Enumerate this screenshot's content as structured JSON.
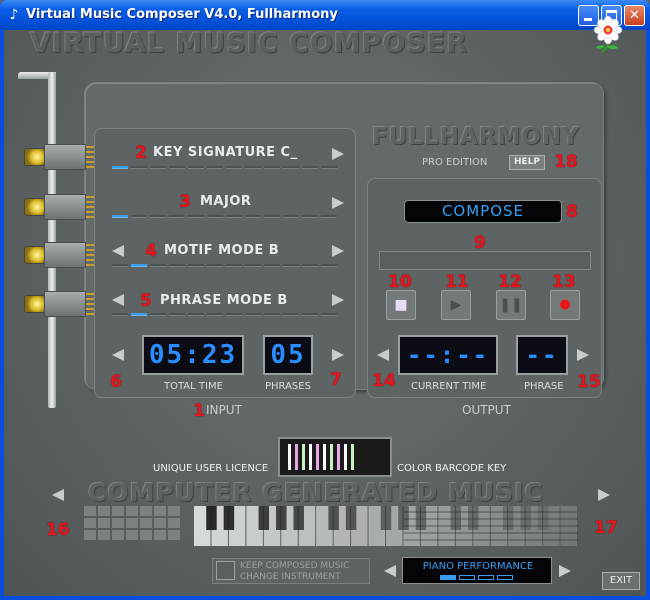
{
  "window": {
    "title": "Virtual Music Composer V4.0, Fullharmony"
  },
  "header": {
    "app_name": "VIRTUAL MUSIC COMPOSER",
    "edition_brand": "FULLHARMONY",
    "edition": "PRO EDITION",
    "help_label": "HELP"
  },
  "input": {
    "section_label": "INPUT",
    "rows": [
      {
        "badge": "2",
        "label": "KEY SIGNATURE  C_",
        "active_slot": 0
      },
      {
        "badge": "3",
        "label": "MAJOR",
        "active_slot": 0
      },
      {
        "badge": "4",
        "label": "MOTIF  MODE  B",
        "active_slot": 1
      },
      {
        "badge": "5",
        "label": "PHRASE  MODE  B",
        "active_slot": 1
      }
    ],
    "total_time": "05:23",
    "total_time_label": "TOTAL TIME",
    "phrases": "05",
    "phrases_label": "PHRASES",
    "badge_section": "1",
    "badge_left": "6",
    "badge_right": "7"
  },
  "output": {
    "section_label": "OUTPUT",
    "compose_label": "COMPOSE",
    "badge_compose": "8",
    "badge_progress": "9",
    "badge_help": "18",
    "controls": [
      {
        "badge": "10",
        "name": "stop-icon"
      },
      {
        "badge": "11",
        "name": "play-icon"
      },
      {
        "badge": "12",
        "name": "pause-icon"
      },
      {
        "badge": "13",
        "name": "record-icon"
      }
    ],
    "current_time": "--:--",
    "current_time_label": "CURRENT TIME",
    "phrase": "--",
    "phrase_label": "PHRASE",
    "badge_left": "14",
    "badge_right": "15"
  },
  "licence": {
    "left_label": "UNIQUE USER LICENCE",
    "right_label": "COLOR BARCODE KEY",
    "bar_colors": [
      "#ffffff",
      "#e8a8e8",
      "#c8f0c0",
      "#ffffff",
      "#e8a8e8",
      "#ffffff",
      "#c8f0c0",
      "#e8a8e8",
      "#ffffff",
      "#c8f0c0"
    ]
  },
  "bottom": {
    "banner": "COMPUTER GENERATED MUSIC",
    "badge_left": "16",
    "badge_right": "17",
    "keep_line1": "KEEP COMPOSED MUSIC",
    "keep_line2": "CHANGE INSTRUMENT",
    "performance_label": "PIANO PERFORMANCE",
    "performance_active_slot": 0,
    "exit_label": "EXIT"
  },
  "colors": {
    "accent": "#3a9ef0",
    "badge": "#e8141e",
    "panel": "#5e6464"
  }
}
